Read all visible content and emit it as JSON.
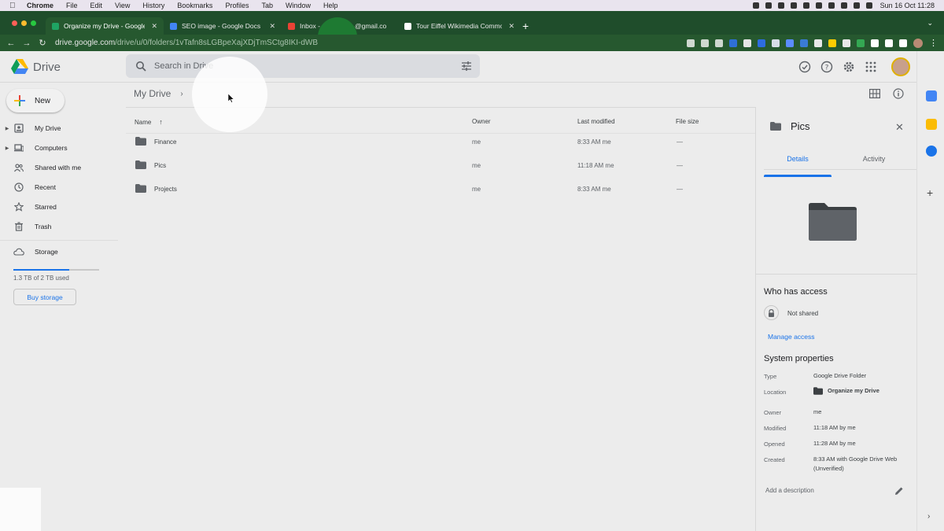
{
  "mac_menu": {
    "app": "Chrome",
    "items": [
      "File",
      "Edit",
      "View",
      "History",
      "Bookmarks",
      "Profiles",
      "Tab",
      "Window",
      "Help"
    ],
    "clock": "Sun 16 Oct  11:28"
  },
  "browser": {
    "tabs": [
      {
        "title": "Organize my Drive - Google Dr",
        "favicon_color": "#1fa463",
        "active": true
      },
      {
        "title": "SEO image - Google Docs",
        "favicon_color": "#4285f4",
        "active": false
      },
      {
        "title": "Inbox -",
        "favicon_color": "#ea4335",
        "active": false
      },
      {
        "title": "@gmail.co",
        "favicon_color": "#ea4335",
        "active": false
      },
      {
        "title": "Tour Eiffel Wikimedia Commons",
        "favicon_color": "#ffffff",
        "active": false
      }
    ],
    "url_host": "drive.google.com",
    "url_path": "/drive/u/0/folders/1vTafn8sLGBpeXajXDjTmSCtg8IKI-dWB"
  },
  "header": {
    "logo_text": "Drive",
    "search_placeholder": "Search in Drive",
    "icons": [
      "offline-status-icon",
      "help-icon",
      "settings-icon",
      "apps-grid-icon"
    ]
  },
  "sidebar": {
    "new_label": "New",
    "items": [
      {
        "label": "My Drive",
        "icon": "my-drive-icon",
        "has_caret": true
      },
      {
        "label": "Computers",
        "icon": "computers-icon",
        "has_caret": true
      },
      {
        "label": "Shared with me",
        "icon": "shared-icon",
        "has_caret": false
      },
      {
        "label": "Recent",
        "icon": "clock-icon",
        "has_caret": false
      },
      {
        "label": "Starred",
        "icon": "star-icon",
        "has_caret": false
      },
      {
        "label": "Trash",
        "icon": "trash-icon",
        "has_caret": false
      }
    ],
    "storage_label": "Storage",
    "storage_used_text": "1.3 TB of 2 TB used",
    "storage_fraction": 0.65,
    "buy_storage": "Buy storage"
  },
  "main": {
    "breadcrumb": "My Drive",
    "columns": {
      "name": "Name",
      "owner": "Owner",
      "modified": "Last modified",
      "size": "File size"
    },
    "rows": [
      {
        "name": "Finance",
        "owner": "me",
        "modified": "8:33 AM  me",
        "size": "—"
      },
      {
        "name": "Pics",
        "owner": "me",
        "modified": "11:18 AM  me",
        "size": "—"
      },
      {
        "name": "Projects",
        "owner": "me",
        "modified": "8:33 AM  me",
        "size": "—"
      }
    ]
  },
  "details": {
    "title": "Pics",
    "tabs": [
      "Details",
      "Activity"
    ],
    "active_tab": "Details",
    "who_has_access": "Who has access",
    "not_shared": "Not shared",
    "manage_access": "Manage access",
    "system_properties": "System properties",
    "properties": {
      "type_label": "Type",
      "type_value": "Google Drive Folder",
      "location_label": "Location",
      "location_value": "Organize my Drive",
      "owner_label": "Owner",
      "owner_value": "me",
      "modified_label": "Modified",
      "modified_value": "11:18 AM by me",
      "opened_label": "Opened",
      "opened_value": "11:28 AM by me",
      "created_label": "Created",
      "created_value": "8:33 AM with Google Drive Web (Unverified)"
    },
    "add_description": "Add a description"
  },
  "colors": {
    "accent": "#1a73e8",
    "tab_strip": "#1f4d2b",
    "toolbar": "#26582f",
    "folder": "#5f6368"
  }
}
